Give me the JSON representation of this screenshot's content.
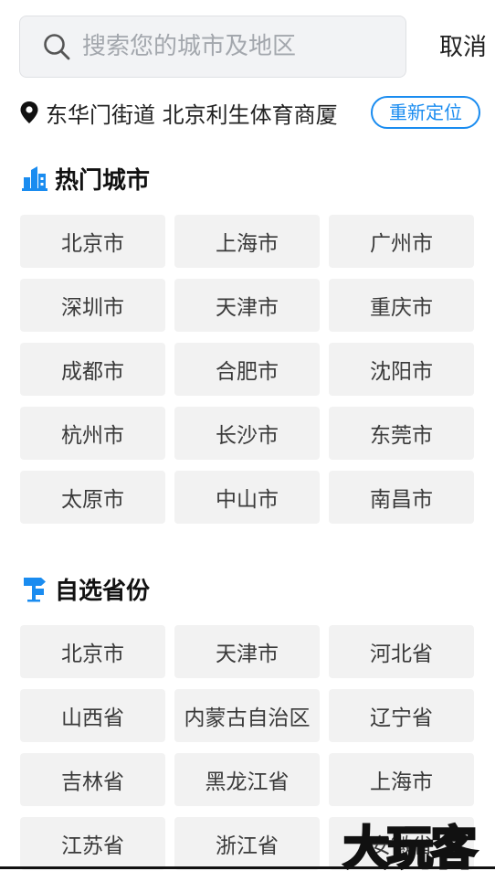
{
  "search": {
    "placeholder": "搜索您的城市及地区",
    "value": "",
    "cancel_label": "取消"
  },
  "location": {
    "text": "东华门街道 北京利生体育商厦",
    "relocate_label": "重新定位"
  },
  "hot_cities": {
    "title": "热门城市",
    "items": [
      "北京市",
      "上海市",
      "广州市",
      "深圳市",
      "天津市",
      "重庆市",
      "成都市",
      "合肥市",
      "沈阳市",
      "杭州市",
      "长沙市",
      "东莞市",
      "太原市",
      "中山市",
      "南昌市"
    ]
  },
  "provinces": {
    "title": "自选省份",
    "items": [
      "北京市",
      "天津市",
      "河北省",
      "山西省",
      "内蒙古自治区",
      "辽宁省",
      "吉林省",
      "黑龙江省",
      "上海市",
      "江苏省",
      "浙江省",
      "安徽省"
    ]
  },
  "watermark": "大玩客",
  "colors": {
    "accent": "#1a8cf0",
    "tile_bg": "#f2f2f2",
    "search_bg": "#f2f3f5"
  }
}
